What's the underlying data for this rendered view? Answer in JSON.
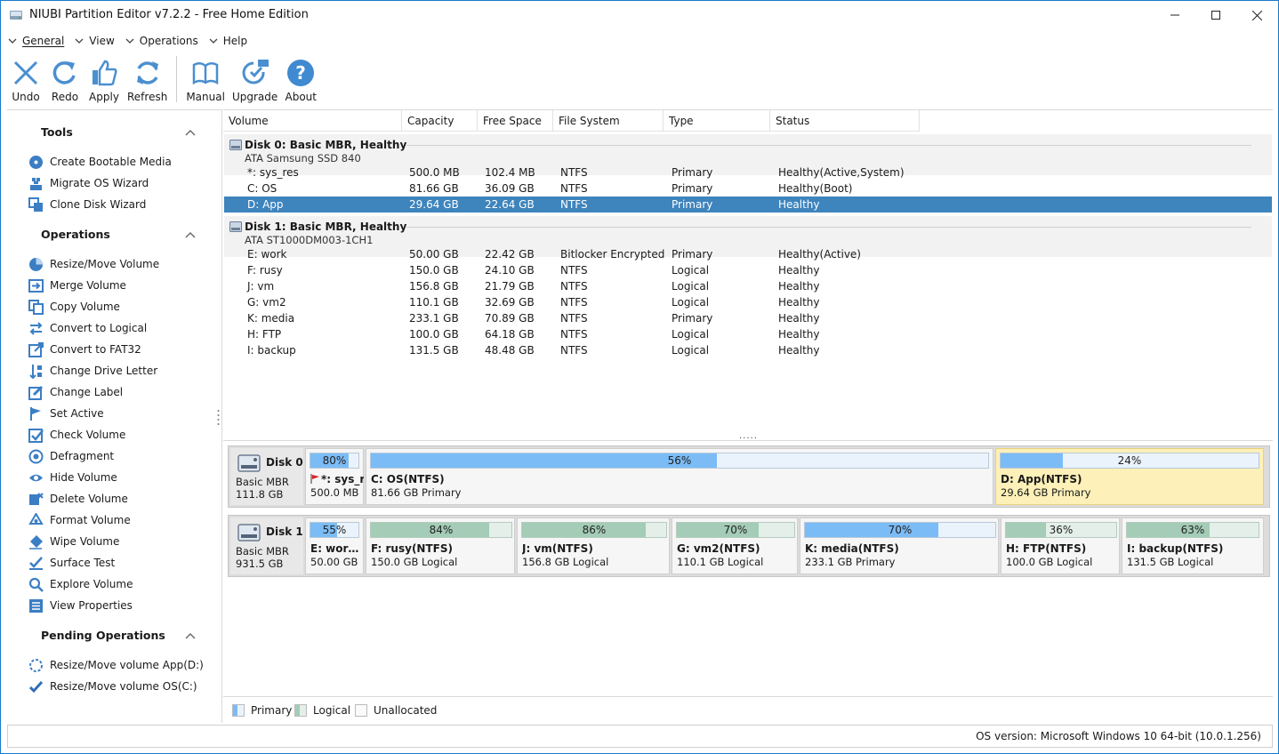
{
  "window": {
    "title": "NIUBI Partition Editor v7.2.2 - Free Home Edition"
  },
  "menu": [
    {
      "label": "General"
    },
    {
      "label": "View"
    },
    {
      "label": "Operations"
    },
    {
      "label": "Help"
    }
  ],
  "toolbar": {
    "undo": "Undo",
    "redo": "Redo",
    "apply": "Apply",
    "refresh": "Refresh",
    "manual": "Manual",
    "upgrade": "Upgrade",
    "about": "About"
  },
  "sidebar": {
    "tools_title": "Tools",
    "tools": [
      "Create Bootable Media",
      "Migrate OS Wizard",
      "Clone Disk Wizard"
    ],
    "operations_title": "Operations",
    "operations": [
      "Resize/Move Volume",
      "Merge Volume",
      "Copy Volume",
      "Convert to Logical",
      "Convert to FAT32",
      "Change Drive Letter",
      "Change Label",
      "Set Active",
      "Check Volume",
      "Defragment",
      "Hide Volume",
      "Delete Volume",
      "Format Volume",
      "Wipe Volume",
      "Surface Test",
      "Explore Volume",
      "View Properties"
    ],
    "pending_title": "Pending Operations",
    "pending": [
      "Resize/Move volume App(D:)",
      "Resize/Move volume OS(C:)"
    ]
  },
  "table": {
    "columns": [
      "Volume",
      "Capacity",
      "Free Space",
      "File System",
      "Type",
      "Status"
    ],
    "disks": [
      {
        "title": "Disk 0: Basic MBR, Healthy",
        "model": "ATA Samsung SSD 840",
        "rows": [
          [
            "*: sys_res",
            "500.0 MB",
            "102.4 MB",
            "NTFS",
            "Primary",
            "Healthy(Active,System)"
          ],
          [
            "C: OS",
            "81.66 GB",
            "36.09 GB",
            "NTFS",
            "Primary",
            "Healthy(Boot)"
          ],
          [
            "D: App",
            "29.64 GB",
            "22.64 GB",
            "NTFS",
            "Primary",
            "Healthy"
          ]
        ]
      },
      {
        "title": "Disk 1: Basic MBR, Healthy",
        "model": "ATA ST1000DM003-1CH1",
        "rows": [
          [
            "E: work",
            "50.00 GB",
            "22.42 GB",
            "Bitlocker Encrypted",
            "Primary",
            "Healthy(Active)"
          ],
          [
            "F: rusy",
            "150.0 GB",
            "24.10 GB",
            "NTFS",
            "Logical",
            "Healthy"
          ],
          [
            "J: vm",
            "156.8 GB",
            "21.79 GB",
            "NTFS",
            "Logical",
            "Healthy"
          ],
          [
            "G: vm2",
            "110.1 GB",
            "32.69 GB",
            "NTFS",
            "Logical",
            "Healthy"
          ],
          [
            "K: media",
            "233.1 GB",
            "70.89 GB",
            "NTFS",
            "Primary",
            "Healthy"
          ],
          [
            "H: FTP",
            "100.0 GB",
            "64.18 GB",
            "NTFS",
            "Logical",
            "Healthy"
          ],
          [
            "I: backup",
            "131.5 GB",
            "48.48 GB",
            "NTFS",
            "Logical",
            "Healthy"
          ]
        ]
      }
    ],
    "selected_row": "D: App"
  },
  "diskmap": [
    {
      "name": "Disk 0",
      "type": "Basic MBR",
      "size": "111.8 GB",
      "partitions": [
        {
          "pct": "80%",
          "used": 0.8,
          "name": "*: sys_res",
          "detail": "500.0 MB",
          "kind": "primary"
        },
        {
          "pct": "56%",
          "used": 0.56,
          "name": "C: OS(NTFS)",
          "detail": "81.66 GB Primary",
          "kind": "primary"
        },
        {
          "pct": "24%",
          "used": 0.24,
          "name": "D: App(NTFS)",
          "detail": "29.64 GB Primary",
          "kind": "primary",
          "selected": true
        }
      ]
    },
    {
      "name": "Disk 1",
      "type": "Basic MBR",
      "size": "931.5 GB",
      "partitions": [
        {
          "pct": "55%",
          "used": 0.55,
          "name": "E: work(NTFS)",
          "detail": "50.00 GB",
          "kind": "primary"
        },
        {
          "pct": "84%",
          "used": 0.84,
          "name": "F: rusy(NTFS)",
          "detail": "150.0 GB Logical",
          "kind": "logical"
        },
        {
          "pct": "86%",
          "used": 0.86,
          "name": "J: vm(NTFS)",
          "detail": "156.8 GB Logical",
          "kind": "logical"
        },
        {
          "pct": "70%",
          "used": 0.7,
          "name": "G: vm2(NTFS)",
          "detail": "110.1 GB Logical",
          "kind": "logical"
        },
        {
          "pct": "70%",
          "used": 0.7,
          "name": "K: media(NTFS)",
          "detail": "233.1 GB Primary",
          "kind": "primary"
        },
        {
          "pct": "36%",
          "used": 0.36,
          "name": "H: FTP(NTFS)",
          "detail": "100.0 GB Logical",
          "kind": "logical"
        },
        {
          "pct": "63%",
          "used": 0.63,
          "name": "I: backup(NTFS)",
          "detail": "131.5 GB Logical",
          "kind": "logical"
        }
      ]
    }
  ],
  "legend": {
    "primary": "Primary",
    "logical": "Logical",
    "unallocated": "Unallocated"
  },
  "status": {
    "os_version": "OS version: Microsoft Windows 10  64-bit  (10.0.1.256)"
  },
  "colors": {
    "accent": "#3e84bd",
    "primary_fill": "#7cbcf6",
    "logical_fill": "#a4ccb6",
    "selected_partition": "#fdf0b8"
  }
}
